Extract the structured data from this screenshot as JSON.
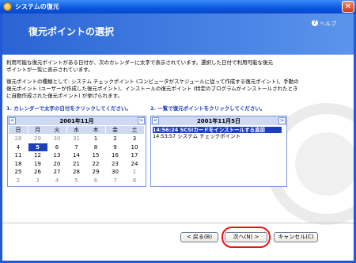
{
  "window": {
    "title": "システムの復元",
    "close_label": "✕",
    "icon_name": "system-restore-icon"
  },
  "header": {
    "title": "復元ポイントの選択",
    "help": "ヘルプ",
    "help_icon": "?"
  },
  "paragraphs": [
    "利用可能な復元ポイントがある日付が、次のカレンダーに太字で表示されています。選択した日付で利用可能な復元",
    "ポイントが一覧に表示されています。",
    "復元ポイントの種類として: システム チェックポイント (コンピュータがスケジュールに従って作成する復元ポイント)、手動の",
    "復元ポイント (ユーザーが作成した復元ポイント)、インストールの復元ポイント (特定のプログラムがインストールされたとき",
    "に自動作成された復元ポイント) が挙げられます。"
  ],
  "instructions": {
    "step1": "1. カレンダーで太字の日付をクリックしてください。",
    "step2": "2. 一覧で復元ポイントをクリックしてください。"
  },
  "calendar": {
    "title": "2001年11月",
    "prev": "<",
    "next": ">",
    "weekdays": [
      "日",
      "月",
      "火",
      "水",
      "木",
      "金",
      "土"
    ],
    "weeks": [
      [
        {
          "d": "28",
          "o": true
        },
        {
          "d": "29",
          "o": true
        },
        {
          "d": "30",
          "o": true
        },
        {
          "d": "31",
          "o": true
        },
        {
          "d": "1"
        },
        {
          "d": "2"
        },
        {
          "d": "3"
        }
      ],
      [
        {
          "d": "4"
        },
        {
          "d": "5",
          "sel": true
        },
        {
          "d": "6"
        },
        {
          "d": "7"
        },
        {
          "d": "8"
        },
        {
          "d": "9"
        },
        {
          "d": "10"
        }
      ],
      [
        {
          "d": "11"
        },
        {
          "d": "12"
        },
        {
          "d": "13"
        },
        {
          "d": "14"
        },
        {
          "d": "15"
        },
        {
          "d": "16"
        },
        {
          "d": "17"
        }
      ],
      [
        {
          "d": "18"
        },
        {
          "d": "19"
        },
        {
          "d": "20"
        },
        {
          "d": "21"
        },
        {
          "d": "22"
        },
        {
          "d": "23"
        },
        {
          "d": "24"
        }
      ],
      [
        {
          "d": "25"
        },
        {
          "d": "26"
        },
        {
          "d": "27"
        },
        {
          "d": "28"
        },
        {
          "d": "29"
        },
        {
          "d": "30"
        },
        {
          "d": "1",
          "o": true
        }
      ],
      [
        {
          "d": "2",
          "o": true
        },
        {
          "d": "3",
          "o": true
        },
        {
          "d": "4",
          "o": true
        },
        {
          "d": "5",
          "o": true
        },
        {
          "d": "6",
          "o": true
        },
        {
          "d": "7",
          "o": true
        },
        {
          "d": "8",
          "o": true
        }
      ]
    ]
  },
  "restore_list": {
    "title": "2001年11月5日",
    "prev": "<",
    "next": ">",
    "items": [
      {
        "label": "14:56:24 SCSIカードをインストールする直前",
        "selected": true
      },
      {
        "label": "14:53:57 システム チェックポイント",
        "selected": false
      }
    ]
  },
  "buttons": {
    "back": "< 戻る(B)",
    "next": "次へ(N) >",
    "cancel": "キャンセル(C)"
  },
  "colors": {
    "accent": "#1c40b8",
    "header": "#2a64d4",
    "highlight": "#ee1111"
  }
}
